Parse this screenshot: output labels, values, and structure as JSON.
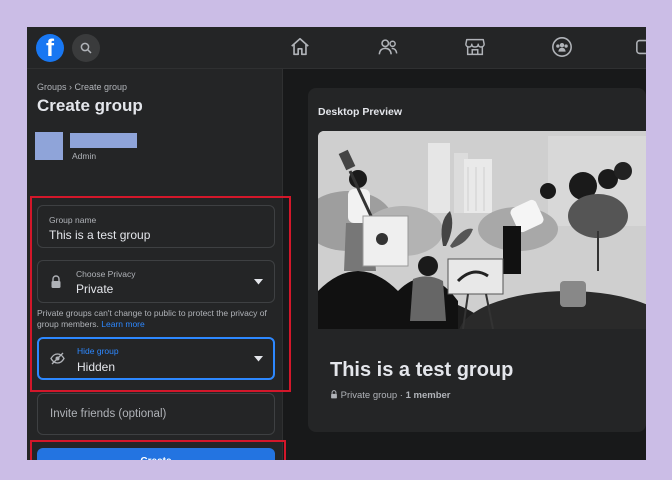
{
  "left": {
    "breadcrumb": "Groups › Create group",
    "title": "Create group",
    "admin_label": "Admin",
    "group_name": {
      "label": "Group name",
      "value": "This is a test group"
    },
    "privacy": {
      "label": "Choose Privacy",
      "value": "Private"
    },
    "privacy_note": "Private groups can't change to public to protect the privacy of group members.",
    "learn_more": "Learn more",
    "hide_group": {
      "label": "Hide group",
      "value": "Hidden"
    },
    "invite_placeholder": "Invite friends (optional)",
    "create_label": "Create"
  },
  "preview": {
    "title": "Desktop Preview",
    "group_name": "This is a test group",
    "privacy_text": "Private group",
    "separator": " · ",
    "members": "1 member"
  },
  "colors": {
    "accent": "#2374e1",
    "highlight_border": "#d3172a",
    "background": "#cbbde6"
  },
  "icons": [
    "facebook-logo-icon",
    "search-icon",
    "home-icon",
    "friends-icon",
    "marketplace-icon",
    "groups-icon",
    "lock-icon",
    "eye-slash-icon",
    "caret-down-icon"
  ]
}
